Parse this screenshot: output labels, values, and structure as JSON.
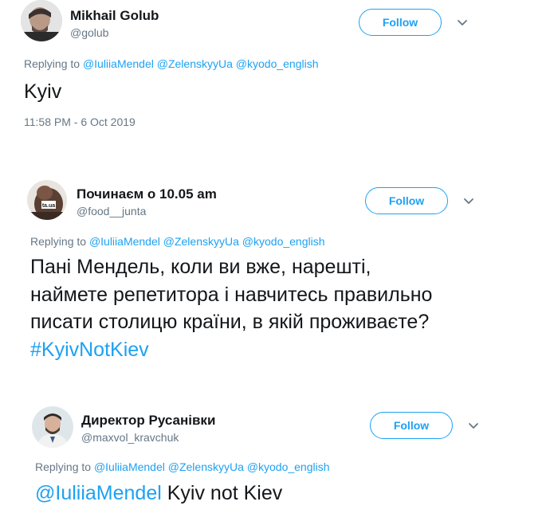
{
  "tweets": [
    {
      "name": "Mikhail Golub",
      "handle": "@golub",
      "follow_label": "Follow",
      "reply_prefix": "Replying to",
      "mentions": [
        "@IuliiaMendel",
        "@ZelenskyyUa",
        "@kyodo_english"
      ],
      "text": "Kyiv",
      "timestamp": "11:58 PM - 6 Oct 2019"
    },
    {
      "name": "Починаєм о 10.05 am",
      "handle": "@food__junta",
      "follow_label": "Follow",
      "reply_prefix": "Replying to",
      "mentions": [
        "@IuliiaMendel",
        "@ZelenskyyUa",
        "@kyodo_english"
      ],
      "text_lines": [
        "Пані Мендель, коли ви вже, нарешті,",
        "наймете репетитора і навчитесь правильно",
        "писати столицю країни, в якій проживаєте?"
      ],
      "hashtag": "#KyivNotKiev"
    },
    {
      "name": "Директор Русанівки",
      "handle": "@maxvol_kravchuk",
      "follow_label": "Follow",
      "reply_prefix": "Replying to",
      "mentions": [
        "@IuliiaMendel",
        "@ZelenskyyUa",
        "@kyodo_english"
      ],
      "text_mention": "@IuliiaMendel",
      "text": "Kyiv not Kiev"
    }
  ],
  "colors": {
    "accent": "#1da1f2",
    "secondary_text": "#657786",
    "primary_text": "#14171a"
  },
  "icons": [
    "avatar",
    "chevron-down-icon"
  ]
}
